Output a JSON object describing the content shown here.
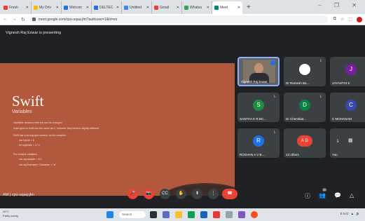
{
  "browser": {
    "tabs": [
      {
        "label": "Fresh",
        "color": "#ea4335"
      },
      {
        "label": "My Driv",
        "color": "#fbbc04"
      },
      {
        "label": "Welcom",
        "color": "#1a73e8"
      },
      {
        "label": "DELTEC",
        "color": "#3367d6"
      },
      {
        "label": "Untitled",
        "color": "#4285f4"
      },
      {
        "label": "Gmail",
        "color": "#ea4335"
      },
      {
        "label": "Whatsa",
        "color": "#34a853"
      },
      {
        "label": "Meet",
        "color": "#00897b",
        "active": true
      }
    ],
    "new_tab": "+",
    "window_controls": "– ❐ ✕",
    "url": "meet.google.com/cpo-uqaq-jfm?authuser=1&hl=en",
    "nav": [
      "←",
      "→",
      "↻"
    ]
  },
  "meet": {
    "presenting_label": "Vignesh Raj Eswar is presenting",
    "slide": {
      "title": "Swift",
      "subtitle": "Variables",
      "bullets": [
        "Variables declared with var can be changed",
        "Data types in Swift are the same as C, however they behave slightly different",
        "Swift has a strong type system, so the compiler",
        "var myvar = 8",
        "let mylimitle = 17.1",
        "For multiple variables",
        "var myvariable = 8.0",
        "var myCharacter: Character = \"A\""
      ]
    },
    "participants": [
      {
        "name": "Vignesh Raj Eswar",
        "type": "video",
        "speaking": true
      },
      {
        "name": "Dr Ramesh Ba...",
        "type": "avatar",
        "initial": "",
        "color": "#ffffff"
      },
      {
        "name": "JAYANTHI S",
        "type": "avatar",
        "initial": "J",
        "color": "#7b1fa2"
      },
      {
        "name": "SANTHA K R BC...",
        "type": "avatar",
        "initial": "S",
        "color": "#1e8e3e"
      },
      {
        "name": "Dr Chembiar...",
        "type": "avatar",
        "initial": "D",
        "color": "#0b8043"
      },
      {
        "name": "C MOHANAM",
        "type": "avatar",
        "initial": "C",
        "color": "#3949ab"
      },
      {
        "name": "ROSHAN A V B...",
        "type": "avatar",
        "initial": "R",
        "color": "#1a73e8"
      },
      {
        "name": "13 others",
        "type": "avatar",
        "initial": "A D",
        "color": "#ea4335"
      },
      {
        "name": "You",
        "type": "avatar",
        "initial": "",
        "color": "#5f6368"
      }
    ],
    "meeting_code": "cpo-uqaq-jfm",
    "time": "AM",
    "controls": {
      "mic": "🎤",
      "camera": "📷",
      "captions": "CC",
      "raise_hand": "✋",
      "present": "⬆",
      "more": "⋮",
      "end_call": "☎"
    },
    "right_controls": {
      "info": "ⓘ",
      "people": "👥",
      "people_count": "20",
      "chat": "💬",
      "activities": "△"
    }
  },
  "taskbar": {
    "weather_line1": "26°C",
    "weather_line2": "Partly sunny",
    "search": "Search",
    "tray": "ENG ▲ 🔊"
  }
}
